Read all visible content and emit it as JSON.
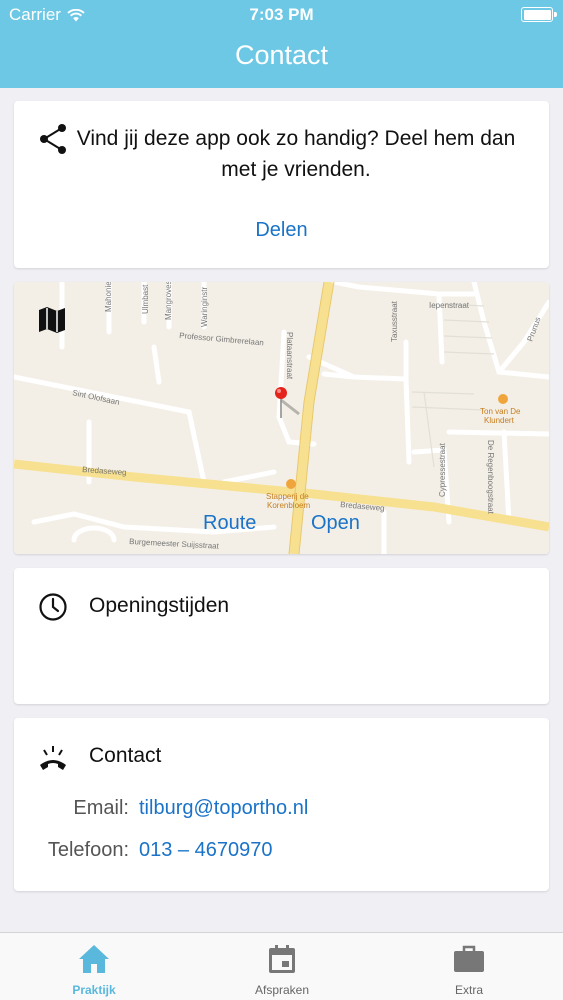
{
  "status_bar": {
    "carrier": "Carrier",
    "time": "7:03 PM"
  },
  "nav": {
    "title": "Contact"
  },
  "share": {
    "text": "Vind jij deze app ook zo handig? Deel hem dan met je vrienden.",
    "action_label": "Delen"
  },
  "map": {
    "route_label": "Route",
    "open_label": "Open",
    "labels": {
      "street_mahonies": "Mahonies",
      "street_ulmbast": "Ulmbast",
      "street_mangroves": "Mangroves",
      "street_waringinstr": "Waringinstr",
      "street_professor": "Professor Gimbrerelaan",
      "street_plataanstraat": "Plataanstraat",
      "street_sint_olofsaan": "Sint Olofsaan",
      "street_bredaseweg_1": "Bredaseweg",
      "street_bredaseweg_2": "Bredaseweg",
      "street_burgemeester": "Burgemeester Suijsstraat",
      "street_iepenstraat": "Iepenstraat",
      "street_taxusstraat": "Taxusstraat",
      "street_cypressestraat": "Cypressestraat",
      "street_regenboog": "De Regenboogstraat",
      "street_prunus": "Prunus",
      "poi_ton_line1": "Ton van De",
      "poi_ton_line2": "Klundert",
      "poi_stapperij_line1": "Stapperij de",
      "poi_stapperij_line2": "Korenbloem"
    }
  },
  "hours": {
    "title": "Openingstijden"
  },
  "contact": {
    "title": "Contact",
    "email_label": "Email:",
    "email_value": "tilburg@toportho.nl",
    "phone_label": "Telefoon:",
    "phone_value": "013 – 4670970"
  },
  "tabs": [
    {
      "label": "Praktijk",
      "icon": "home-icon",
      "active": true
    },
    {
      "label": "Afspraken",
      "icon": "calendar-icon",
      "active": false
    },
    {
      "label": "Extra",
      "icon": "briefcase-icon",
      "active": false
    }
  ],
  "colors": {
    "accent": "#6cc8e4",
    "link": "#1a73c8",
    "active_tab": "#5ab8dc"
  }
}
